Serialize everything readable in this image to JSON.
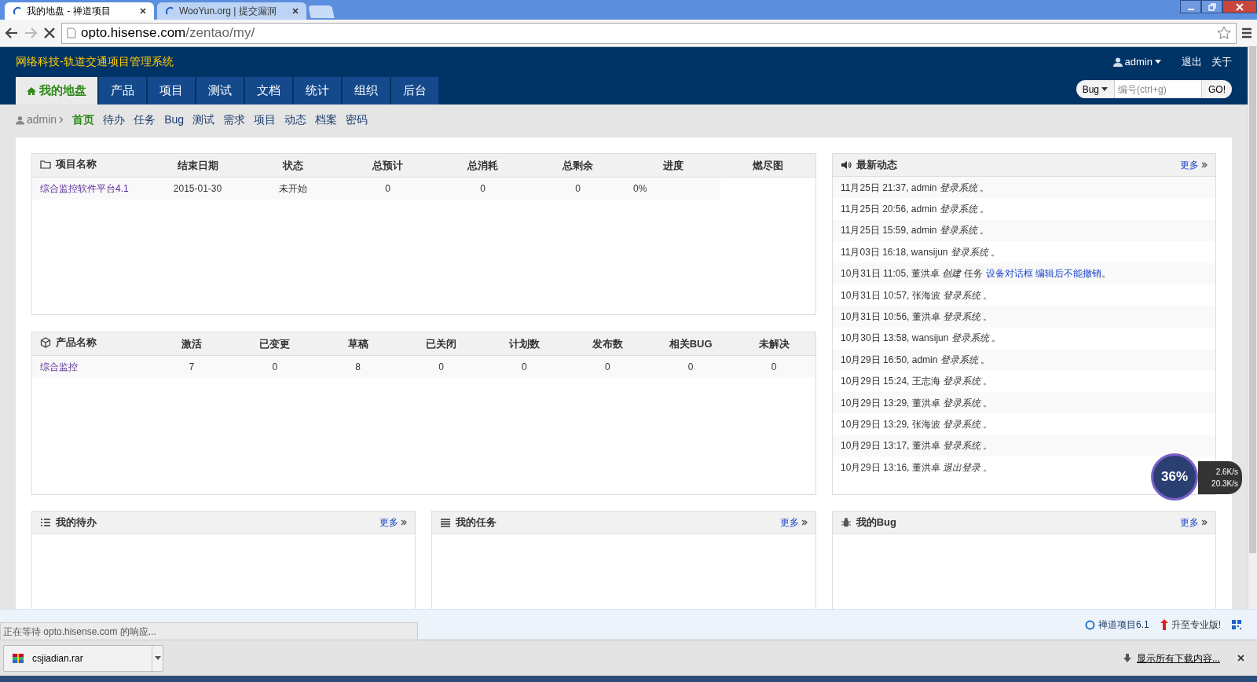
{
  "browser": {
    "tabs": [
      {
        "title": "我的地盘 - 禅道项目",
        "selected": true
      },
      {
        "title": "WooYun.org | 提交漏洞",
        "selected": false
      }
    ],
    "url_host": "opto.hisense.com",
    "url_path": "/zentao/my/"
  },
  "header": {
    "title": "网络科技-轨道交通项目管理系统",
    "user": "admin",
    "links": [
      "退出",
      "关于"
    ],
    "search": {
      "type": "Bug",
      "placeholder": "编号(ctrl+g)",
      "button": "GO!"
    },
    "nav": [
      {
        "label": "我的地盘",
        "selected": true
      },
      {
        "label": "产品",
        "selected": false
      },
      {
        "label": "项目",
        "selected": false
      },
      {
        "label": "测试",
        "selected": false
      },
      {
        "label": "文档",
        "selected": false
      },
      {
        "label": "统计",
        "selected": false
      },
      {
        "label": "组织",
        "selected": false
      },
      {
        "label": "后台",
        "selected": false
      }
    ]
  },
  "subnav": {
    "user": "admin",
    "items": [
      {
        "label": "首页",
        "selected": true
      },
      {
        "label": "待办",
        "selected": false
      },
      {
        "label": "任务",
        "selected": false
      },
      {
        "label": "Bug",
        "selected": false
      },
      {
        "label": "测试",
        "selected": false
      },
      {
        "label": "需求",
        "selected": false
      },
      {
        "label": "项目",
        "selected": false
      },
      {
        "label": "动态",
        "selected": false
      },
      {
        "label": "档案",
        "selected": false
      },
      {
        "label": "密码",
        "selected": false
      }
    ]
  },
  "projects": {
    "columns": [
      "项目名称",
      "结束日期",
      "状态",
      "总预计",
      "总消耗",
      "总剩余",
      "进度",
      "燃尽图"
    ],
    "rows": [
      {
        "cells": [
          "综合监控软件平台4.1",
          "2015-01-30",
          "未开始",
          "0",
          "0",
          "0",
          "0%"
        ]
      }
    ]
  },
  "products": {
    "columns": [
      "产品名称",
      "激活",
      "已变更",
      "草稿",
      "已关闭",
      "计划数",
      "发布数",
      "相关BUG",
      "未解决"
    ],
    "rows": [
      {
        "cells": [
          "综合监控",
          "7",
          "0",
          "8",
          "0",
          "0",
          "0",
          "0",
          "0"
        ]
      }
    ]
  },
  "dynamics": {
    "title": "最新动态",
    "more": "更多",
    "items": [
      {
        "text": "11月25日 21:37, admin *登录系统* 。"
      },
      {
        "text": "11月25日 20:56, admin *登录系统* 。"
      },
      {
        "text": "11月25日 15:59, admin *登录系统* 。"
      },
      {
        "text": "11月03日 16:18, wansijun *登录系统* 。"
      },
      {
        "text": "10月31日 11:05, 董洪卓 *创建* 任务",
        "link": "设备对话框 编辑后不能撤销",
        "after": "。"
      },
      {
        "text": "10月31日 10:57, 张海波 *登录系统* 。"
      },
      {
        "text": "10月31日 10:56, 董洪卓 *登录系统* 。"
      },
      {
        "text": "10月30日 13:58, wansijun *登录系统* 。"
      },
      {
        "text": "10月29日 16:50, admin *登录系统* 。"
      },
      {
        "text": "10月29日 15:24, 王志海 *登录系统* 。"
      },
      {
        "text": "10月29日 13:29, 董洪卓 *登录系统* 。"
      },
      {
        "text": "10月29日 13:29, 张海波 *登录系统* 。"
      },
      {
        "text": "10月29日 13:17, 董洪卓 *登录系统* 。"
      },
      {
        "text": "10月29日 13:16, 董洪卓 *退出登录* 。"
      }
    ]
  },
  "blocks": [
    {
      "kind": "todo",
      "title": "我的待办",
      "more": "更多"
    },
    {
      "kind": "task",
      "title": "我的任务",
      "more": "更多"
    },
    {
      "kind": "bug",
      "title": "我的Bug",
      "more": "更多"
    }
  ],
  "footer": {
    "version": "禅道项目6.1",
    "upgrade": "升至专业版!"
  },
  "status": "正在等待 opto.hisense.com 的响应...",
  "downloads": {
    "file": "csjiadian.rar",
    "show_all": "显示所有下载内容..."
  },
  "speed_widget": {
    "percent": "36%",
    "up": "2.6K/s",
    "down": "20.3K/s"
  }
}
